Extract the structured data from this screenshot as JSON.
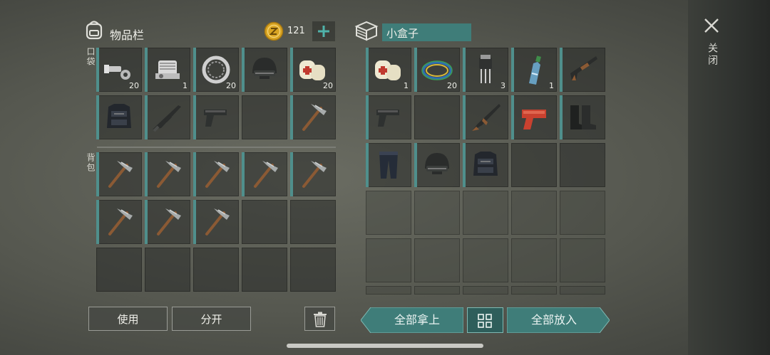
{
  "inventory": {
    "title": "物品栏",
    "coins": "121",
    "pocket_label": "口袋",
    "backpack_label": "背包",
    "pocket_slots": [
      {
        "icon": "bolt-nut-icon",
        "count": "20"
      },
      {
        "icon": "engine-part-icon",
        "count": "1"
      },
      {
        "icon": "bearing-ring-icon",
        "count": "20"
      },
      {
        "icon": "helmet-icon",
        "count": ""
      },
      {
        "icon": "bandage-icon",
        "count": "20"
      },
      {
        "icon": "body-armor-icon",
        "count": ""
      },
      {
        "icon": "rifle-icon",
        "count": ""
      },
      {
        "icon": "pistol-icon",
        "count": ""
      },
      {
        "icon": "empty",
        "count": ""
      },
      {
        "icon": "pickaxe-icon",
        "count": ""
      }
    ],
    "backpack_slots": [
      {
        "icon": "pickaxe-icon"
      },
      {
        "icon": "pickaxe-icon"
      },
      {
        "icon": "pickaxe-icon"
      },
      {
        "icon": "pickaxe-icon"
      },
      {
        "icon": "pickaxe-icon"
      },
      {
        "icon": "pickaxe-icon"
      },
      {
        "icon": "pickaxe-icon"
      },
      {
        "icon": "pickaxe-icon"
      },
      {
        "icon": "empty"
      },
      {
        "icon": "empty"
      },
      {
        "icon": "empty"
      },
      {
        "icon": "empty"
      },
      {
        "icon": "empty"
      },
      {
        "icon": "empty"
      },
      {
        "icon": "empty"
      }
    ],
    "use_label": "使用",
    "split_label": "分开"
  },
  "container": {
    "title": "小盒子",
    "slots": [
      {
        "icon": "bandage-icon",
        "count": "1"
      },
      {
        "icon": "wire-coil-icon",
        "count": "20"
      },
      {
        "icon": "transistor-icon",
        "count": "3"
      },
      {
        "icon": "water-bottle-icon",
        "count": "1"
      },
      {
        "icon": "shotgun-icon",
        "count": ""
      },
      {
        "icon": "pistol-icon",
        "count": ""
      },
      {
        "icon": "empty",
        "count": ""
      },
      {
        "icon": "ak-rifle-icon",
        "count": ""
      },
      {
        "icon": "flare-gun-icon",
        "count": ""
      },
      {
        "icon": "boots-icon",
        "count": ""
      },
      {
        "icon": "pants-icon",
        "count": ""
      },
      {
        "icon": "helmet-icon",
        "count": ""
      },
      {
        "icon": "body-armor-icon",
        "count": ""
      }
    ],
    "take_all_label": "全部拿上",
    "put_all_label": "全部放入"
  },
  "close_label": "关闭",
  "colors": {
    "accent": "#3f7d79",
    "bar": "#4f8f8c",
    "coin": "#d9a523"
  }
}
